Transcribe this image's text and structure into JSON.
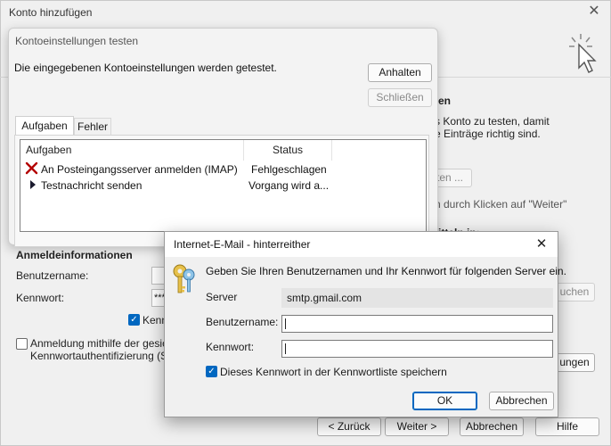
{
  "window": {
    "title": "Konto hinzufügen",
    "close_glyph": "✕"
  },
  "bg": {
    "right_heading": "en",
    "right_line1": "s Konto zu testen, damit",
    "right_line2": "e Einträge richtig sind.",
    "right_button1": "ten ...",
    "right_line3": "n durch Klicken auf \"Weiter\"",
    "right_bold_partial": "itteln in:",
    "suchen_button": "uchen",
    "ungen_button": "ungen",
    "anmelde_heading": "Anmeldeinformationen",
    "benutzername_label": "Benutzername:",
    "kennwort_label": "Kennwort:",
    "kennwort_value": "***",
    "remember_label_partial": "Kenn",
    "spa_label_line1": "Anmeldung mithilfe der gesic",
    "spa_label_line2": "Kennwortauthentifizierung (S"
  },
  "footer": {
    "back": "< Zurück",
    "next": "Weiter >",
    "cancel": "Abbrechen",
    "help": "Hilfe"
  },
  "test_dialog": {
    "title": "Kontoeinstellungen testen",
    "message": "Die eingegebenen Kontoeinstellungen werden getestet.",
    "stop_button": "Anhalten",
    "close_button": "Schließen",
    "tabs": [
      "Aufgaben",
      "Fehler"
    ],
    "columns": [
      "Aufgaben",
      "Status"
    ],
    "rows": [
      {
        "task": "An Posteingangsserver anmelden (IMAP)",
        "status": "Fehlgeschlagen",
        "icon": "failed-x-icon"
      },
      {
        "task": "Testnachricht senden",
        "status": "Vorgang wird a...",
        "icon": "running-arrow-icon"
      }
    ]
  },
  "login_dialog": {
    "title": "Internet-E-Mail - hinterreither",
    "close_glyph": "✕",
    "prompt": "Geben Sie Ihren Benutzernamen und Ihr Kennwort für folgenden Server ein.",
    "server_label": "Server",
    "server_value": "smtp.gmail.com",
    "username_label": "Benutzername:",
    "username_value": "",
    "password_label": "Kennwort:",
    "password_value": "",
    "save_password_label": "Dieses Kennwort in der Kennwortliste speichern",
    "save_password_checked": true,
    "ok_button": "OK",
    "cancel_button": "Abbrechen",
    "icon": "keys-icon"
  },
  "colors": {
    "accent": "#0067c0",
    "failed": "#b30000"
  }
}
